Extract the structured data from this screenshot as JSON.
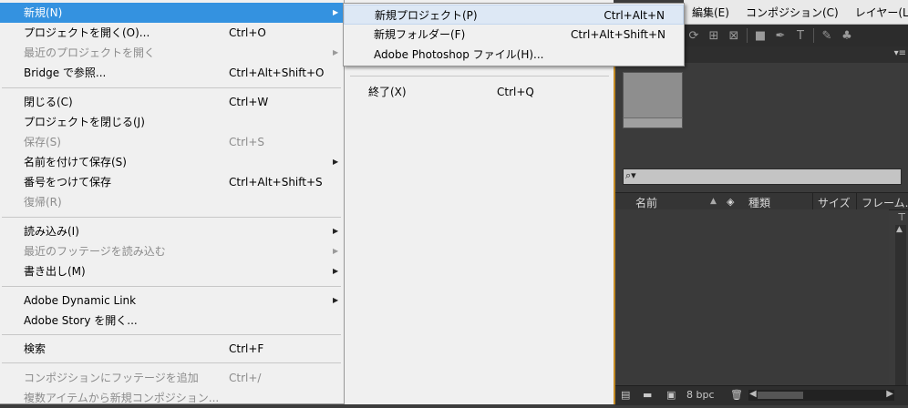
{
  "app_menubar": {
    "items": [
      "編集(E)",
      "コンポジション(C)",
      "レイヤー(L)"
    ]
  },
  "toolbar": {
    "icons": [
      "rotate-icon",
      "camera-icon",
      "pan-icon",
      "rectangle-icon",
      "pen-icon",
      "text-icon",
      "brush-icon",
      "stamp-icon"
    ]
  },
  "main_menu": {
    "items": [
      {
        "label": "新規(N)",
        "shortcut": "",
        "submenu": true,
        "disabled": false,
        "highlight": true
      },
      {
        "label": "プロジェクトを開く(O)...",
        "shortcut": "Ctrl+O",
        "submenu": false,
        "disabled": false
      },
      {
        "label": "最近のプロジェクトを開く",
        "shortcut": "",
        "submenu": true,
        "disabled": true
      },
      {
        "label": "Bridge で参照...",
        "shortcut": "Ctrl+Alt+Shift+O",
        "submenu": false,
        "disabled": false
      },
      {
        "label": "閉じる(C)",
        "shortcut": "Ctrl+W",
        "submenu": false,
        "disabled": false
      },
      {
        "label": "プロジェクトを閉じる(J)",
        "shortcut": "",
        "submenu": false,
        "disabled": false
      },
      {
        "label": "保存(S)",
        "shortcut": "Ctrl+S",
        "submenu": false,
        "disabled": true
      },
      {
        "label": "名前を付けて保存(S)",
        "shortcut": "",
        "submenu": true,
        "disabled": false
      },
      {
        "label": "番号をつけて保存",
        "shortcut": "Ctrl+Alt+Shift+S",
        "submenu": false,
        "disabled": false
      },
      {
        "label": "復帰(R)",
        "shortcut": "",
        "submenu": false,
        "disabled": true
      },
      {
        "label": "読み込み(I)",
        "shortcut": "",
        "submenu": true,
        "disabled": false
      },
      {
        "label": "最近のフッテージを読み込む",
        "shortcut": "",
        "submenu": true,
        "disabled": true
      },
      {
        "label": "書き出し(M)",
        "shortcut": "",
        "submenu": true,
        "disabled": false
      },
      {
        "label": "Adobe Dynamic Link",
        "shortcut": "",
        "submenu": true,
        "disabled": false
      },
      {
        "label": "Adobe Story を開く...",
        "shortcut": "",
        "submenu": false,
        "disabled": false
      },
      {
        "label": "検索",
        "shortcut": "Ctrl+F",
        "submenu": false,
        "disabled": false
      },
      {
        "label": "コンポジションにフッテージを追加",
        "shortcut": "Ctrl+/",
        "submenu": false,
        "disabled": true
      },
      {
        "label": "複数アイテムから新規コンポジション...",
        "shortcut": "",
        "submenu": false,
        "disabled": true
      }
    ]
  },
  "behind_menu": {
    "exit_label": "終了(X)",
    "exit_shortcut": "Ctrl+Q"
  },
  "submenu_new": {
    "items": [
      {
        "label": "新規プロジェクト(P)",
        "shortcut": "Ctrl+Alt+N"
      },
      {
        "label": "新規フォルダー(F)",
        "shortcut": "Ctrl+Alt+Shift+N"
      },
      {
        "label": "Adobe Photoshop ファイル(H)...",
        "shortcut": ""
      }
    ]
  },
  "project_panel": {
    "columns": [
      "名前",
      "種類",
      "サイズ",
      "フレーム..."
    ],
    "search_placeholder": "",
    "bpc_label": "8 bpc"
  }
}
